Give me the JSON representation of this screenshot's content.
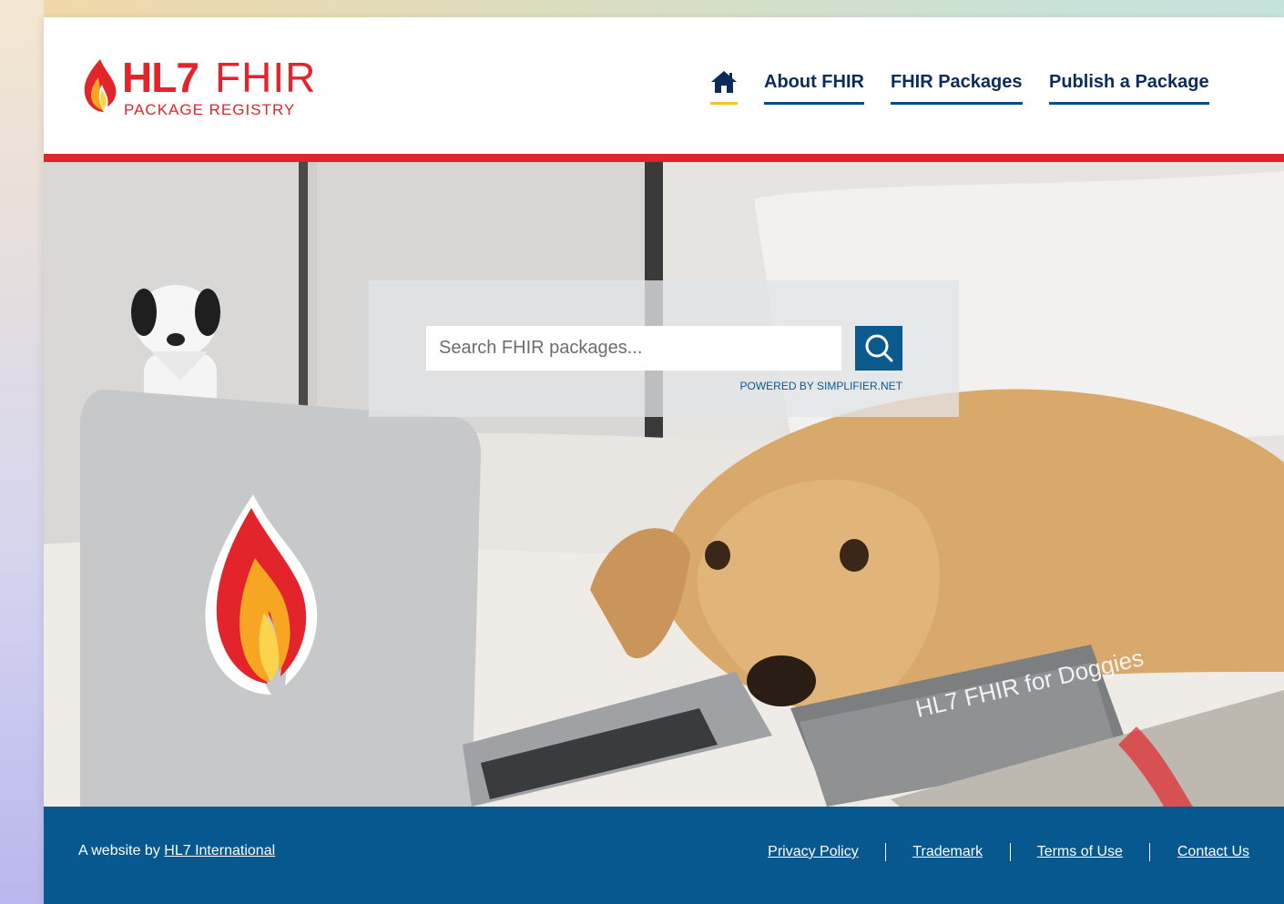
{
  "brand": {
    "hl7": "HL7",
    "fhir": "FHIR",
    "subtitle": "PACKAGE REGISTRY"
  },
  "nav": {
    "home_icon": "home-icon",
    "items": [
      {
        "label": "About FHIR"
      },
      {
        "label": "FHIR Packages"
      },
      {
        "label": "Publish a Package"
      }
    ]
  },
  "search": {
    "placeholder": "Search FHIR packages...",
    "value": "",
    "button_icon": "search-icon",
    "powered_by": "POWERED BY SIMPLIFIER.NET"
  },
  "hero": {
    "book_text": "HL7 FHIR for Doggies"
  },
  "footer": {
    "prefix": "A website by ",
    "org_link": "HL7 International",
    "links": [
      "Privacy Policy",
      "Trademark",
      "Terms of Use",
      "Contact Us"
    ]
  },
  "colors": {
    "brand_red": "#e3242b",
    "nav_text": "#0b2c5a",
    "footer_blue": "#07588f",
    "search_button": "#0b5a8e",
    "home_underline": "#f2c42d"
  }
}
